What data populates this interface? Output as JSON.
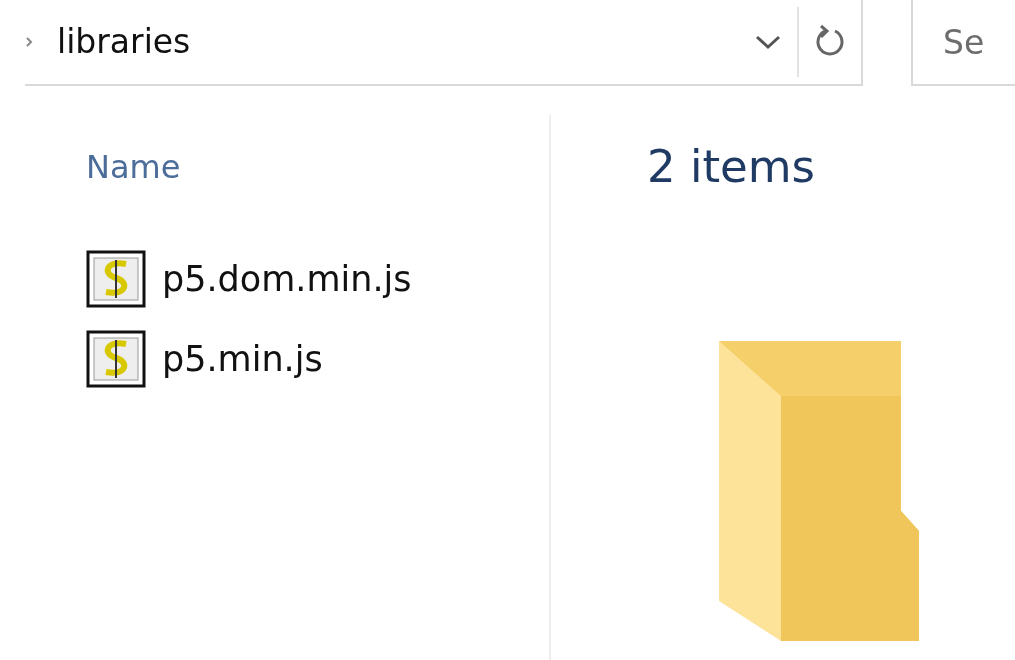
{
  "address_bar": {
    "path": "libraries"
  },
  "search": {
    "placeholder": "Se"
  },
  "column_header": {
    "label": "Name"
  },
  "files": [
    {
      "name": "p5.dom.min.js"
    },
    {
      "name": "p5.min.js"
    }
  ],
  "details": {
    "count": "2 items"
  }
}
